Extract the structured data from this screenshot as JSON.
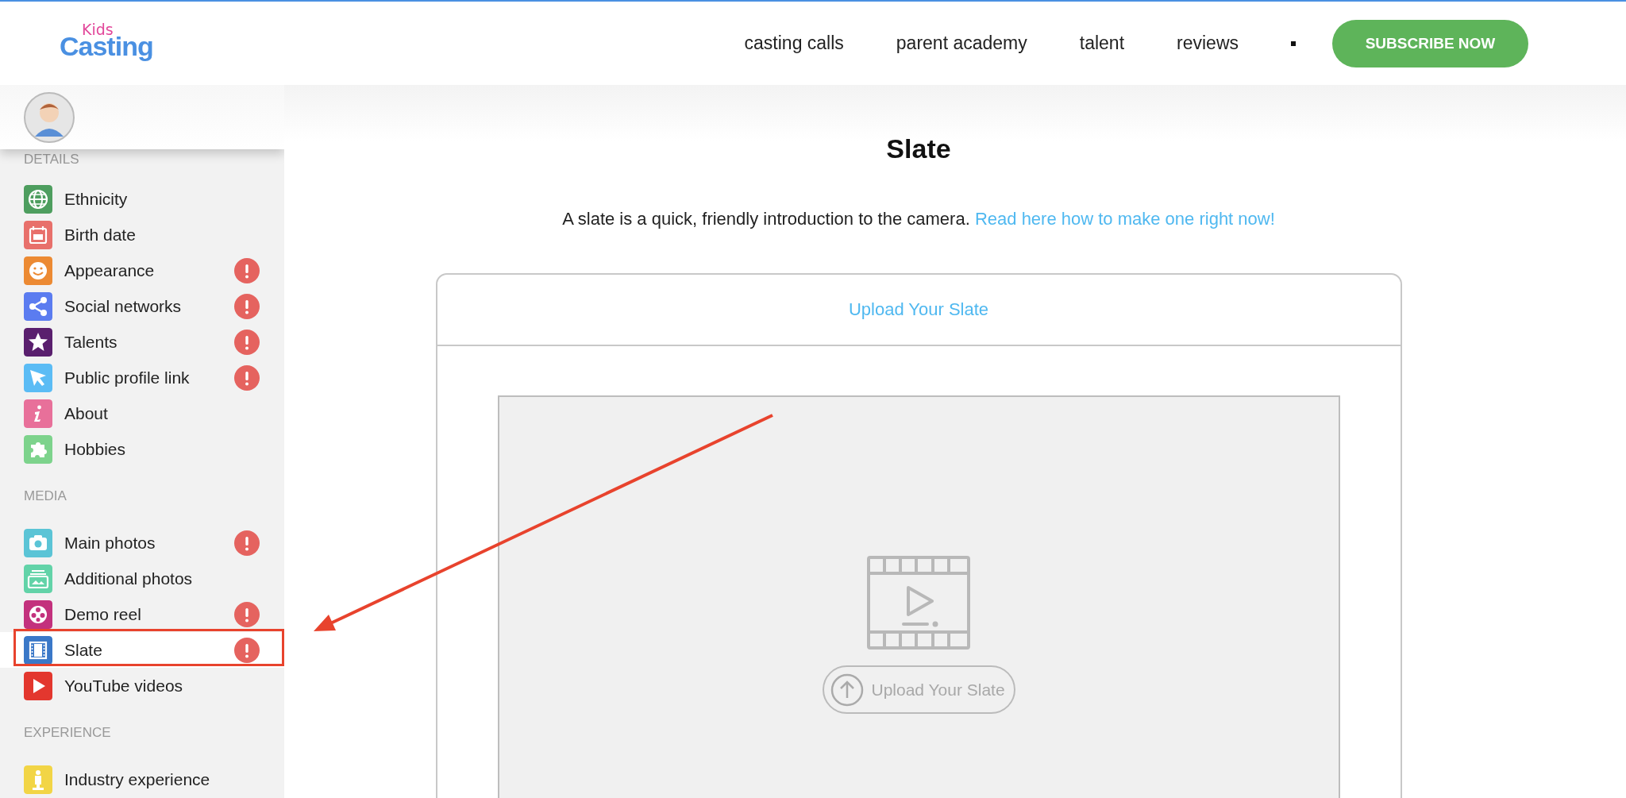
{
  "header": {
    "logo": {
      "small": "Kids",
      "main": "Casting"
    },
    "nav": [
      {
        "label": "casting calls"
      },
      {
        "label": "parent academy"
      },
      {
        "label": "talent"
      },
      {
        "label": "reviews"
      }
    ],
    "subscribe": "SUBSCRIBE NOW"
  },
  "sidebar": {
    "sections": [
      {
        "heading": "DETAILS",
        "items": [
          {
            "label": "Ethnicity",
            "color": "#4e9e5f",
            "alert": false,
            "selected": false
          },
          {
            "label": "Birth date",
            "color": "#e8706b",
            "alert": false,
            "selected": false
          },
          {
            "label": "Appearance",
            "color": "#ec8a33",
            "alert": true,
            "selected": false
          },
          {
            "label": "Social networks",
            "color": "#5b7cf0",
            "alert": true,
            "selected": false
          },
          {
            "label": "Talents",
            "color": "#5a1f6e",
            "alert": true,
            "selected": false
          },
          {
            "label": "Public profile link",
            "color": "#5bbcf5",
            "alert": true,
            "selected": false
          },
          {
            "label": "About",
            "color": "#e8709a",
            "alert": false,
            "selected": false
          },
          {
            "label": "Hobbies",
            "color": "#7dd38c",
            "alert": false,
            "selected": false
          }
        ]
      },
      {
        "heading": "MEDIA",
        "items": [
          {
            "label": "Main photos",
            "color": "#5bc4d6",
            "alert": true,
            "selected": false
          },
          {
            "label": "Additional photos",
            "color": "#62d3a8",
            "alert": false,
            "selected": false
          },
          {
            "label": "Demo reel",
            "color": "#c3317d",
            "alert": true,
            "selected": false
          },
          {
            "label": "Slate",
            "color": "#3a78c8",
            "alert": true,
            "selected": true
          },
          {
            "label": "YouTube videos",
            "color": "#e3372e",
            "alert": false,
            "selected": false
          }
        ]
      },
      {
        "heading": "EXPERIENCE",
        "items": [
          {
            "label": "Industry experience",
            "color": "#f2d546",
            "alert": false,
            "selected": false
          }
        ]
      }
    ]
  },
  "main": {
    "title": "Slate",
    "description": "A slate is a quick, friendly introduction to the camera.",
    "link": "Read here how to make one right now!",
    "card": {
      "header": "Upload Your Slate",
      "upload_button": "Upload Your Slate"
    }
  }
}
